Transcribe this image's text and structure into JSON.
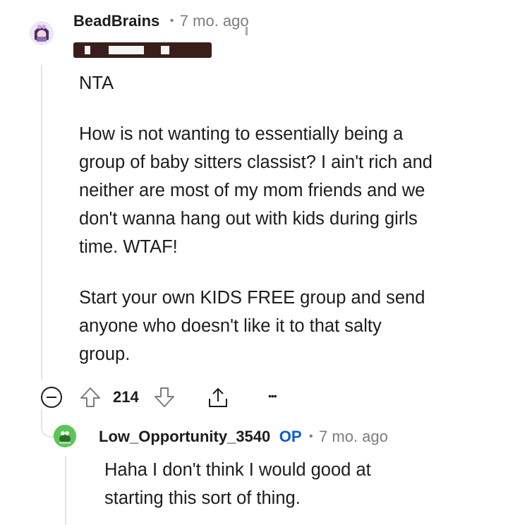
{
  "comment": {
    "username": "BeadBrains",
    "separator": "•",
    "age": "7 mo. ago",
    "paragraphs": [
      [
        "NTA"
      ],
      [
        "How is not wanting to essentially being a",
        "group of baby sitters classist? I ain't rich and",
        "neither are most of my mom friends and we",
        "don't wanna hang out with kids during girls",
        "time. WTAF!"
      ],
      [
        "Start your own KIDS FREE group and send",
        "anyone who doesn't like it to that salty",
        "group."
      ]
    ],
    "score": "214",
    "more_label": "•••"
  },
  "reply": {
    "username": "Low_Opportunity_3540",
    "op_badge": "OP",
    "separator": "•",
    "age": "7 mo. ago",
    "lines": [
      "Haha I don't think I would good at",
      "starting this sort of thing."
    ]
  },
  "icons": {
    "collapse": "collapse-icon",
    "upvote": "upvote-icon",
    "downvote": "downvote-icon",
    "share": "share-icon",
    "more": "more-icon"
  },
  "colors": {
    "text": "#1c1c1c",
    "meta": "#7c7c7c",
    "op": "#0b5bd3",
    "thread_line": "#e4e4e4",
    "redaction": "#3a1e19"
  }
}
